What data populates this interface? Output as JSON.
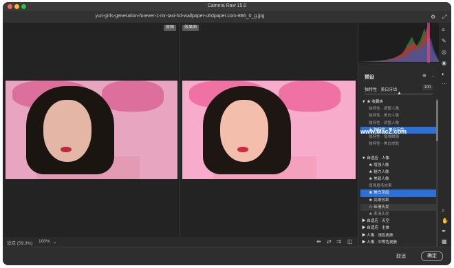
{
  "app": {
    "title": "Camera Raw 15.0",
    "filename": "yuri-girls-generation-forever-1-mr-taxi-hd-wallpaper-uhdpaper.com-866_0_g.jpg"
  },
  "view": {
    "before_label": "原图",
    "after_label": "效果图",
    "zoom_label": "适应 (59.3%)",
    "zoom_value": "100%"
  },
  "presets": {
    "title": "预设",
    "current": "独特性 · 美白牙齿",
    "amount": "100",
    "items": [
      {
        "label": "▼ ★ 收藏夹",
        "kind": "group"
      },
      {
        "label": "独特性 · 调整人像",
        "kind": "dim"
      },
      {
        "label": "独特性 · 美白人像",
        "kind": "dim"
      },
      {
        "label": "独特性 · 调整人像",
        "kind": "dim"
      },
      {
        "label": "★ 独特性 · 美白牙齿",
        "kind": "sel"
      },
      {
        "label": "独特性 · 增强眼睛",
        "kind": "dim"
      },
      {
        "label": "独特性 · 美白皮肤",
        "kind": "dim"
      },
      {
        "label": "",
        "kind": "dim"
      },
      {
        "label": "▼ 自适应 · 人像",
        "kind": "group"
      },
      {
        "label": "★ 增强人像",
        "kind": "item"
      },
      {
        "label": "★ 魅力人像",
        "kind": "item"
      },
      {
        "label": "★ 美颜人像",
        "kind": "item"
      },
      {
        "label": "增强眉毛效果",
        "kind": "dim"
      },
      {
        "label": "★ 美白牙齿",
        "kind": "sel"
      },
      {
        "label": "★ 亮眼效果",
        "kind": "item"
      },
      {
        "label": "☆ 丝滑头发",
        "kind": "hl"
      },
      {
        "label": "★ 柔滑头发",
        "kind": "dim"
      },
      {
        "label": "▶ 自适应 · 天空",
        "kind": "group"
      },
      {
        "label": "▶ 自适应 · 主体",
        "kind": "group"
      },
      {
        "label": "▶ 人像 · 浅色皮肤",
        "kind": "group"
      },
      {
        "label": "▶ 人像 · 中等色皮肤",
        "kind": "group"
      }
    ]
  },
  "watermark": "www.MacZ.com",
  "footer": {
    "cancel": "取消",
    "ok": "确定"
  },
  "icons": {
    "gear": "⚙",
    "expand": "⤢",
    "preset_add": "⊕",
    "more": "…"
  }
}
